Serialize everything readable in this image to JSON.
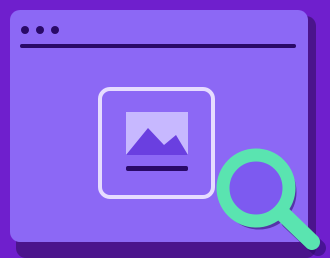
{
  "illustration": {
    "window": {
      "dot_count": 3
    },
    "icons": [
      "browser-window-icon",
      "image-icon",
      "magnifying-glass-icon"
    ],
    "colors": {
      "background": "#6f1fcd",
      "window_shadow": "#4b148c",
      "window": "#8c68f5",
      "ink": "#2a0a68",
      "frame": "#e6dcff",
      "photo_sky": "#c7b8ff",
      "mountains": "#6a3fe0",
      "magnifier": "#5ae4b0",
      "lens": "#7d5af0"
    }
  }
}
